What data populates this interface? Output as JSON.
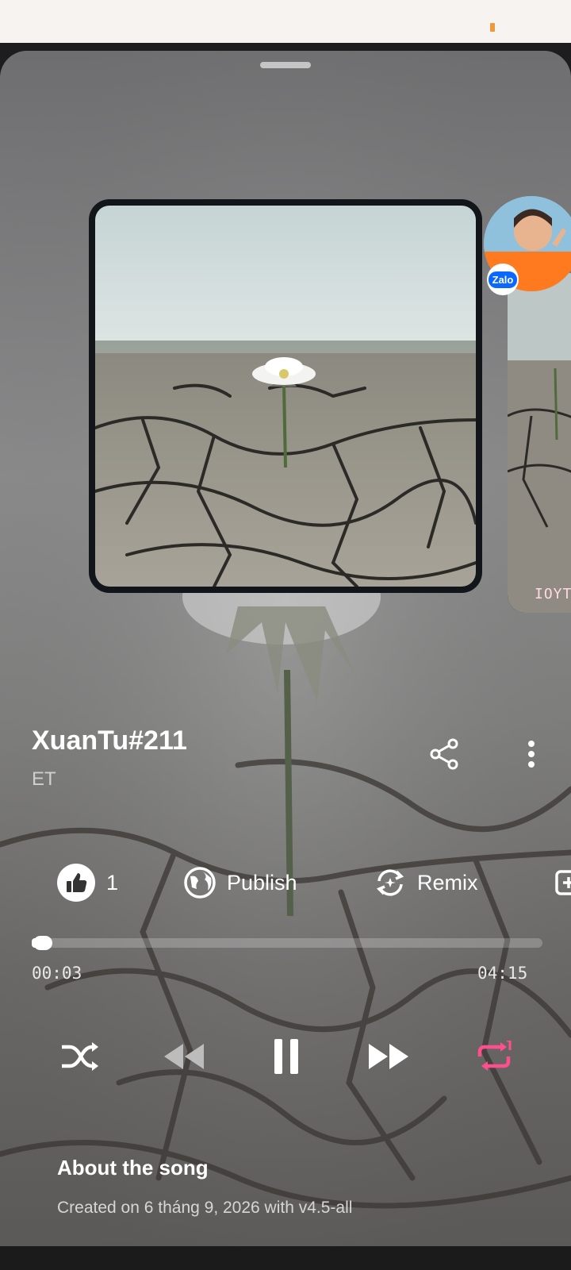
{
  "song": {
    "title": "XuanTu#211",
    "artist": "ET"
  },
  "actions": {
    "like_count": "1",
    "publish_label": "Publish",
    "remix_label": "Remix"
  },
  "player": {
    "elapsed": "00:03",
    "duration": "04:15",
    "progress": 0.012,
    "repeat_mode": "repeat-one"
  },
  "about": {
    "heading": "About the song",
    "created": "Created on 6 tháng 9, 2026 with v4.5-all"
  },
  "next_cover": {
    "caption": "IOYT"
  },
  "overlay": {
    "badge": "Zalo"
  },
  "colors": {
    "accent": "#ff4d8d",
    "sheet": "#7a7a7b",
    "status_bar": "#f7f3f0"
  },
  "icons": [
    "like-icon",
    "globe-icon",
    "remix-icon",
    "share-icon",
    "more-icon",
    "shuffle-icon",
    "previous-icon",
    "pause-icon",
    "next-icon",
    "repeat-one-icon"
  ]
}
